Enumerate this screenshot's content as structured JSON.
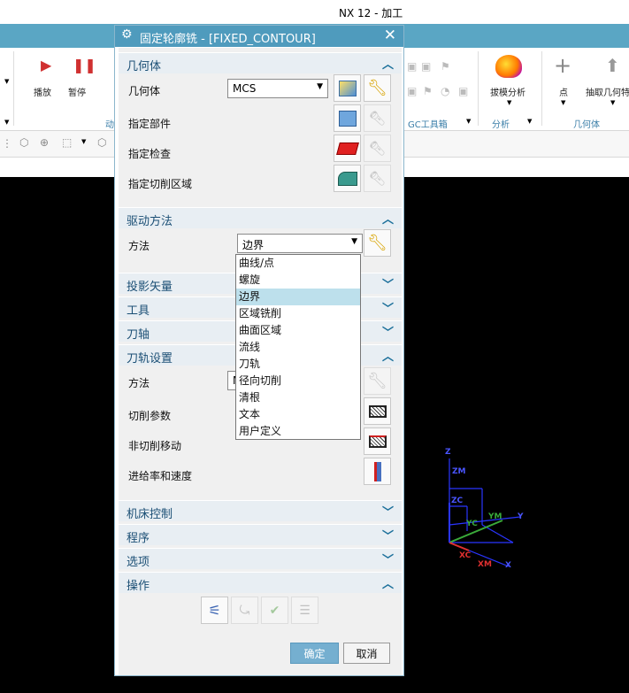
{
  "app": {
    "title": "NX 12 - 加工"
  },
  "ribbon": {
    "play_label": "播放",
    "pause_label": "暂停",
    "anim_group": "动",
    "gc_toolbox": "GC工具箱",
    "draft_analysis": "拔模分析",
    "analysis_group": "分析",
    "point_label": "点",
    "extract_geometry": "抽取几何特",
    "geometry_group": "几何体"
  },
  "dialog": {
    "title": "固定轮廓铣 - [FIXED_CONTOUR]",
    "geometry": {
      "header": "几何体",
      "geometry_label": "几何体",
      "geometry_value": "MCS",
      "specify_part": "指定部件",
      "specify_check": "指定检查",
      "specify_cut_area": "指定切削区域"
    },
    "drive_method": {
      "header": "驱动方法",
      "method_label": "方法",
      "method_value": "边界",
      "options": [
        "曲线/点",
        "螺旋",
        "边界",
        "区域铣削",
        "曲面区域",
        "流线",
        "刀轨",
        "径向切削",
        "清根",
        "文本",
        "用户定义"
      ],
      "selected_option": "边界"
    },
    "collapsed_sections": {
      "projection_vector": "投影矢量",
      "tool": "工具",
      "tool_axis": "刀轴"
    },
    "toolpath_settings": {
      "header": "刀轨设置",
      "method_label": "方法",
      "method_value": "M",
      "cut_params": "切削参数",
      "non_cut_moves": "非切削移动",
      "feeds_speeds": "进给率和速度"
    },
    "more_sections": {
      "machine_control": "机床控制",
      "program": "程序",
      "options": "选项",
      "actions": "操作"
    },
    "ok_label": "确定",
    "cancel_label": "取消"
  },
  "viewport": {
    "axes": {
      "z": "Z",
      "zm": "ZM",
      "zc": "ZC",
      "ym": "YM",
      "y": "Y",
      "yc": "YC",
      "xc": "XC",
      "xm": "XM",
      "x": "X"
    }
  },
  "colors": {
    "accent": "#4f9bbd",
    "section_text": "#1b4f75",
    "selected_item": "#bde0ec"
  }
}
